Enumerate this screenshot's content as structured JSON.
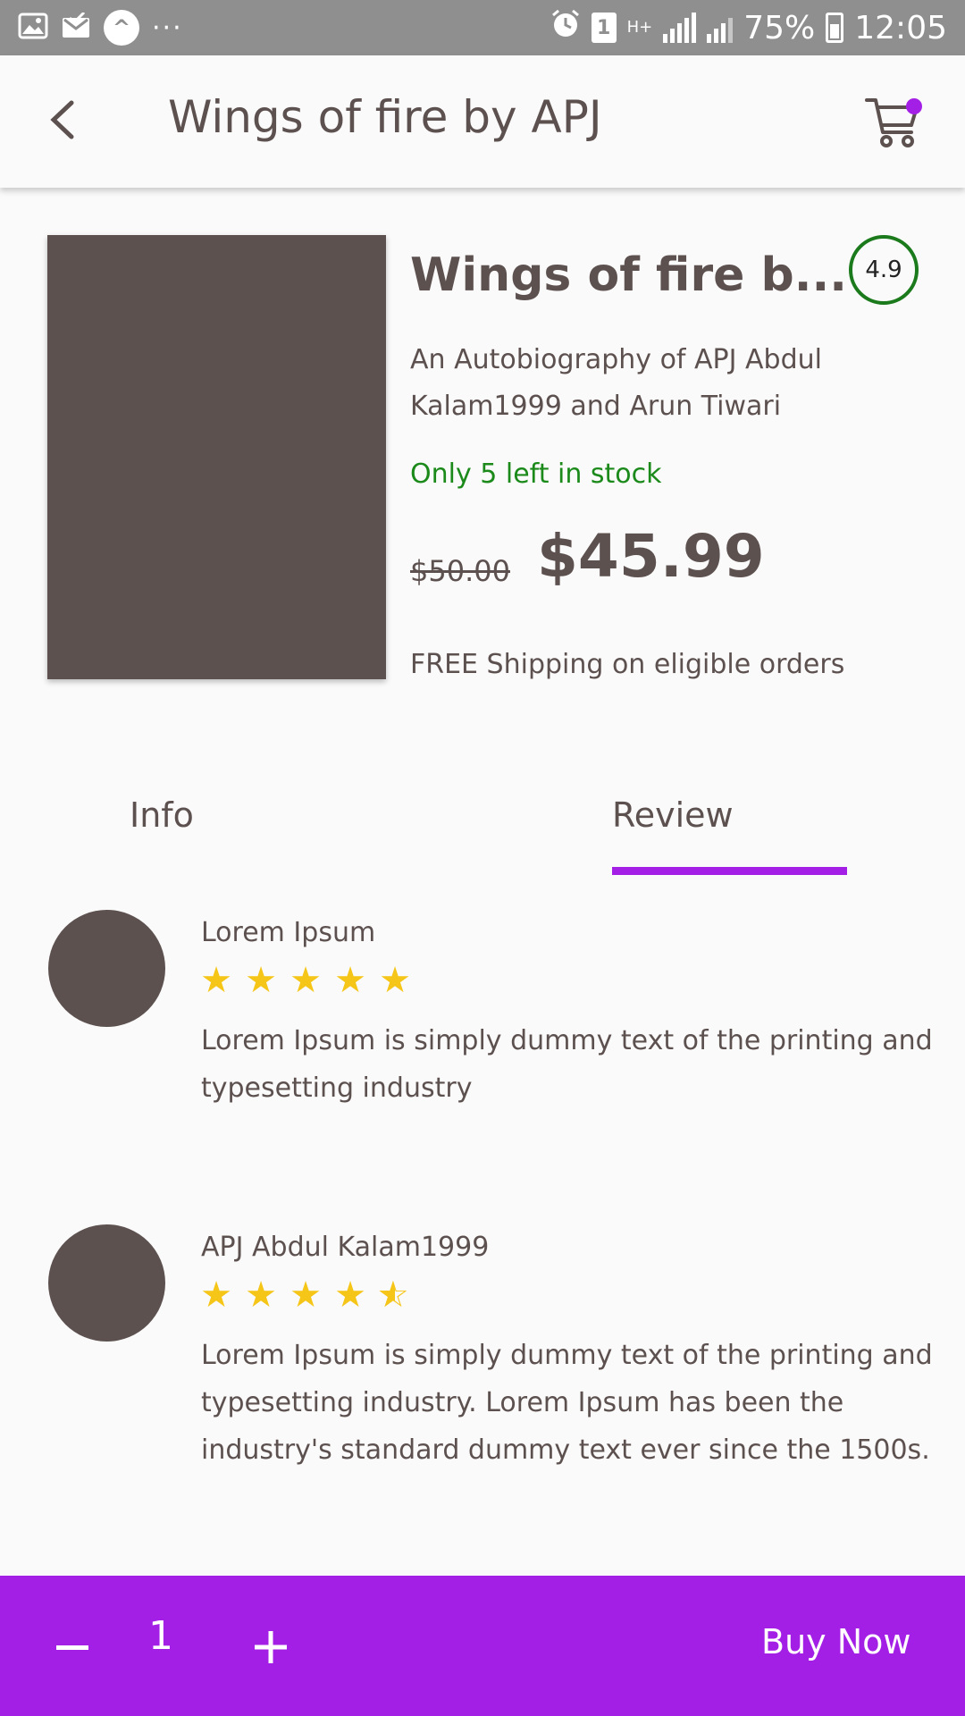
{
  "status_bar": {
    "battery": "75%",
    "time": "12:05",
    "sim_number": "1",
    "network": "H+",
    "icons": [
      "image-icon",
      "mail-check-icon",
      "app-icon",
      "more-dots-icon",
      "alarm-icon",
      "sim-icon",
      "signal-icon",
      "battery-icon"
    ]
  },
  "app_bar": {
    "title": "Wings of fire by APJ",
    "back_icon": "chevron-left-icon",
    "cart_icon": "cart-icon",
    "cart_badge_color": "#a41fe6"
  },
  "product": {
    "title": "Wings of fire b...",
    "rating": "4.9",
    "subtitle": "An Autobiography of APJ Abdul Kalam1999 and Arun Tiwari",
    "stock": "Only 5 left in stock",
    "old_price": "$50.00",
    "price": "$45.99",
    "shipping": "FREE Shipping on eligible orders",
    "cover_color": "#5d5150"
  },
  "tabs": {
    "info": "Info",
    "review": "Review",
    "active": "review"
  },
  "reviews": [
    {
      "name": "Lorem Ipsum",
      "rating": 5,
      "text": "Lorem Ipsum is simply dummy text of the printing and typesetting industry"
    },
    {
      "name": "APJ Abdul Kalam1999",
      "rating": 4.5,
      "text": "Lorem Ipsum is simply dummy text of the printing and typesetting industry. Lorem Ipsum has been the industry's standard dummy text ever since the 1500s."
    }
  ],
  "bottom_bar": {
    "quantity": "1",
    "buy_label": "Buy Now",
    "color": "#a41fe6"
  }
}
